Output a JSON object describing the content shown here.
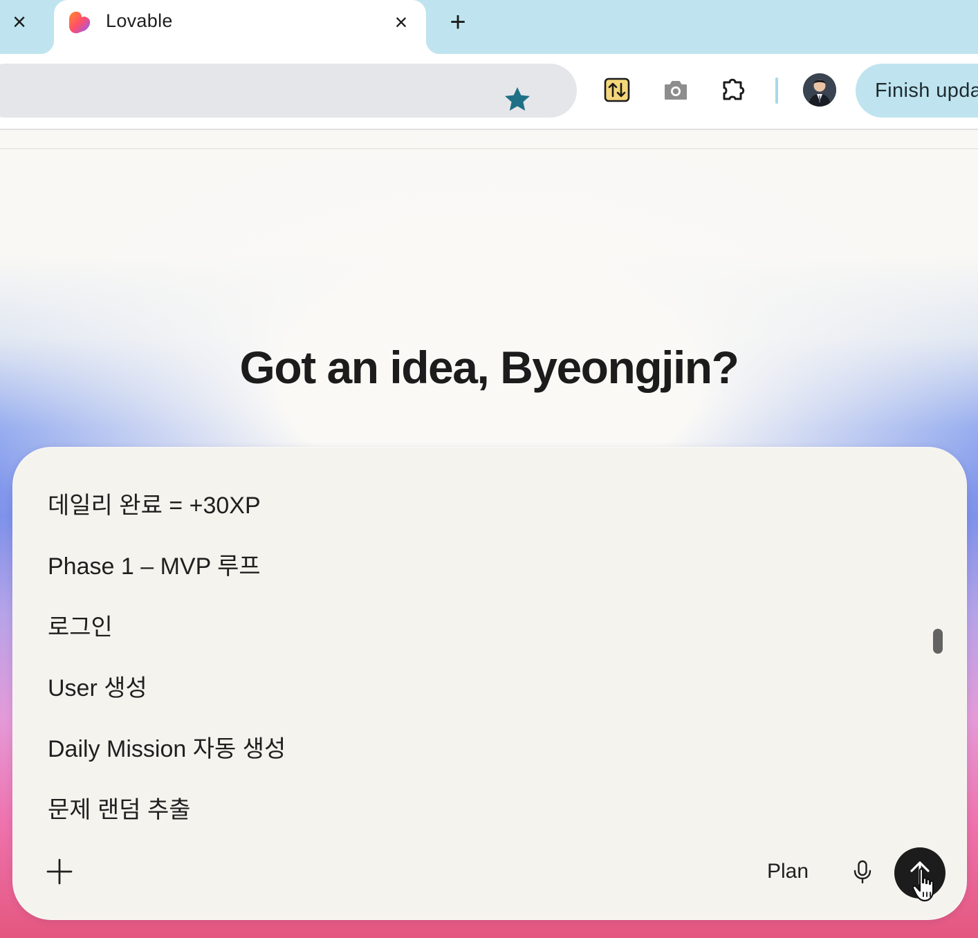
{
  "browser": {
    "tabs": [
      {
        "title": "Lovable",
        "active": true
      }
    ],
    "close_glyph": "×",
    "new_tab_glyph": "+",
    "toolbar": {
      "finish_update_label": "Finish upda",
      "icons": [
        "star-icon",
        "swap-extension-icon",
        "camera-icon",
        "puzzle-extension-icon",
        "profile-avatar"
      ]
    }
  },
  "page": {
    "headline": "Got an idea, Byeongjin?",
    "composer": {
      "lines": [
        "데일리 완료 = +30XP",
        "Phase 1 – MVP 루프",
        "로그인",
        "User 생성",
        "Daily Mission 자동 생성",
        "문제 랜덤 추출"
      ],
      "plan_label": "Plan"
    }
  },
  "colors": {
    "tab_strip": "#bfe4ef",
    "omnibox": "#e5e6ea",
    "star": "#1f6f86",
    "send_button": "#1c1c1c",
    "composer_bg": "#f5f3ee"
  }
}
